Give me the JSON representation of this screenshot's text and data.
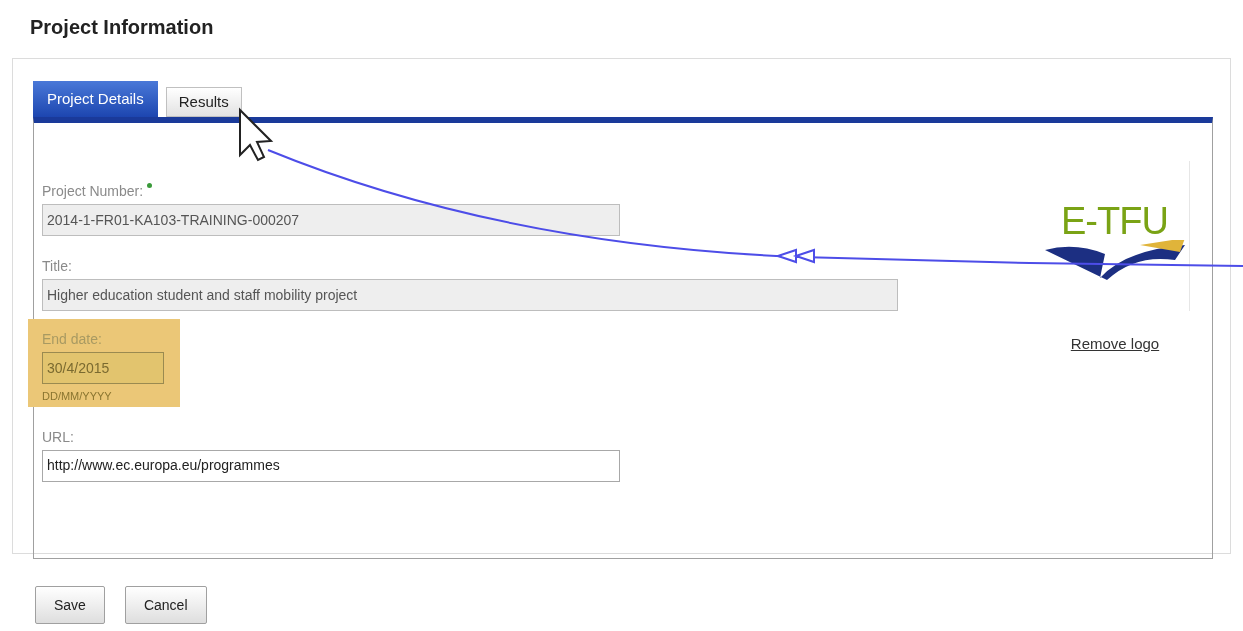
{
  "heading": "Project Information",
  "tabs": [
    {
      "label": "Project Details",
      "selected": true
    },
    {
      "label": "Results",
      "selected": false
    }
  ],
  "fields": [
    {
      "label": "Project Number:",
      "required": true,
      "value": "2014-1-FR01-KA103-TRAINING-000207",
      "disabled": true,
      "highlighted": false
    },
    {
      "label": "Title:",
      "required": false,
      "value": "Higher education student and staff mobility project",
      "disabled": true,
      "highlighted": false
    },
    {
      "label": "End date:",
      "required": false,
      "value": "30/4/2015",
      "hint": "DD/MM/YYYY",
      "disabled": true,
      "highlighted": true
    },
    {
      "label": "URL:",
      "required": false,
      "value": "http://www.ec.europa.eu/programmes",
      "disabled": false,
      "highlighted": false
    }
  ],
  "logo": {
    "text": "E-TFU",
    "remove_link": "Remove logo"
  },
  "buttons": [
    "Save",
    "Cancel"
  ]
}
